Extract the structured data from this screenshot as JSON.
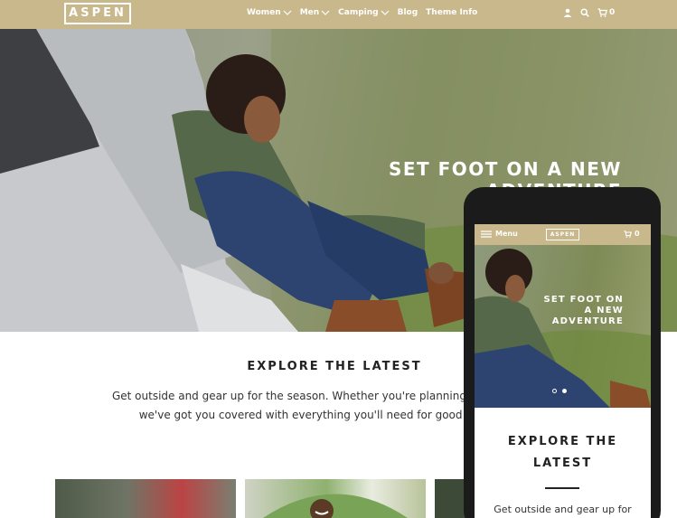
{
  "header": {
    "logo": "ASPEN",
    "nav": [
      {
        "label": "Women"
      },
      {
        "label": "Men"
      },
      {
        "label": "Camping"
      },
      {
        "label": "Blog"
      },
      {
        "label": "Theme Info"
      }
    ],
    "cart_count": "0",
    "icons": [
      "user-icon",
      "search-icon",
      "cart-icon"
    ],
    "bg_color": "#c9b88c"
  },
  "hero": {
    "title_line1": "SET FOOT ON A NEW",
    "title_line2": "ADVENTURE"
  },
  "explore": {
    "heading": "EXPLORE THE LATEST",
    "line1": "Get outside and gear up for the season. Whether you're planning a family campin",
    "line2": "we've got you covered with everything you'll need for good times and a"
  },
  "mobile": {
    "menu_label": "Menu",
    "logo": "ASPEN",
    "cart_count": "0",
    "hero_line1": "SET FOOT ON",
    "hero_line2": "A NEW",
    "hero_line3": "ADVENTURE",
    "explore_line1": "EXPLORE THE",
    "explore_line2": "LATEST",
    "body_text": "Get outside and gear up for"
  }
}
